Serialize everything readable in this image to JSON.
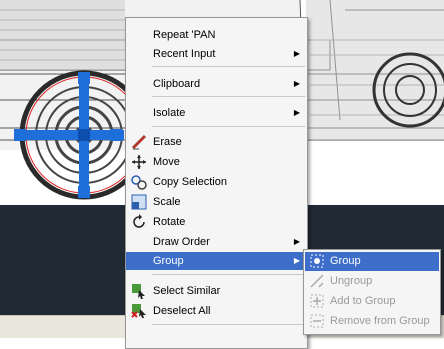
{
  "menu": {
    "items": [
      {
        "label": "Repeat 'PAN",
        "icon": "none"
      },
      {
        "label": "Recent Input",
        "icon": "none",
        "submenu": true
      },
      {
        "label": "Clipboard",
        "icon": "none",
        "submenu": true
      },
      {
        "label": "Isolate",
        "icon": "none",
        "submenu": true
      },
      {
        "label": "Erase",
        "icon": "eraser-icon"
      },
      {
        "label": "Move",
        "icon": "move-icon"
      },
      {
        "label": "Copy Selection",
        "icon": "copy-icon"
      },
      {
        "label": "Scale",
        "icon": "scale-icon"
      },
      {
        "label": "Rotate",
        "icon": "rotate-icon"
      },
      {
        "label": "Draw Order",
        "icon": "none",
        "submenu": true
      },
      {
        "label": "Group",
        "icon": "none",
        "submenu": true,
        "highlighted": true
      },
      {
        "label": "Select Similar",
        "icon": "select-similar-icon"
      },
      {
        "label": "Deselect All",
        "icon": "deselect-icon"
      }
    ]
  },
  "submenu": {
    "items": [
      {
        "label": "Group",
        "enabled": true,
        "highlighted": true
      },
      {
        "label": "Ungroup",
        "enabled": false
      },
      {
        "label": "Add to Group",
        "enabled": false
      },
      {
        "label": "Remove from Group",
        "enabled": false
      }
    ]
  },
  "colors": {
    "highlight": "#3d6ec9",
    "grip": "#1e6fd9",
    "canvas_dark": "#202a34"
  }
}
